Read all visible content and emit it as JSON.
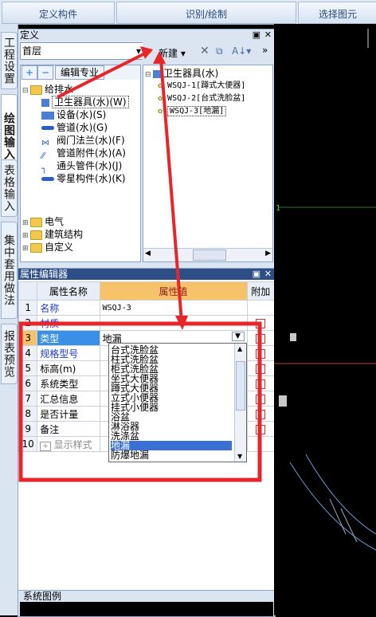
{
  "toolbar": {
    "define_component": "定义构件",
    "identify_draw": "识别/绘制",
    "select_figure": "选择图元"
  },
  "vtabs": [
    {
      "label": "工程设置"
    },
    {
      "label": "绘图输入"
    },
    {
      "label": "表格输入"
    },
    {
      "label": "集中套用做法"
    },
    {
      "label": "报表预览"
    }
  ],
  "define_panel": {
    "title": "定义",
    "floor": "首层",
    "edit_specialty": "编辑专业",
    "tree": {
      "root": "给排水",
      "items": [
        {
          "label": "卫生器具(水)(W)"
        },
        {
          "label": "设备(水)(S)"
        },
        {
          "label": "管道(水)(G)"
        },
        {
          "label": "阀门法兰(水)(F)"
        },
        {
          "label": "管道附件(水)(A)"
        },
        {
          "label": "通头管件(水)(J)"
        },
        {
          "label": "零星构件(水)(K)"
        }
      ],
      "folders": [
        "电气",
        "建筑结构",
        "自定义"
      ]
    },
    "new_button": "新建",
    "list_root": "卫生器具(水)",
    "list_items": [
      "WSQJ-1[蹲式大便器]",
      "WSQJ-2[台式洗脸盆]",
      "WSQJ-3[地漏]"
    ]
  },
  "prop_panel": {
    "title": "属性编辑器",
    "headers": {
      "name": "属性名称",
      "value": "属性值",
      "add": "附加"
    },
    "rows": [
      {
        "num": "1",
        "name": "名称",
        "value": "WSQJ-3"
      },
      {
        "num": "2",
        "name": "材质",
        "value": ""
      },
      {
        "num": "3",
        "name": "类型",
        "value": "地漏"
      },
      {
        "num": "4",
        "name": "规格型号",
        "value": ""
      },
      {
        "num": "5",
        "name": "标高(m)",
        "value": ""
      },
      {
        "num": "6",
        "name": "系统类型",
        "value": ""
      },
      {
        "num": "7",
        "name": "汇总信息",
        "value": ""
      },
      {
        "num": "8",
        "name": "是否计量",
        "value": ""
      },
      {
        "num": "9",
        "name": "备注",
        "value": ""
      },
      {
        "num": "10",
        "name": "显示样式",
        "value": ""
      }
    ],
    "dropdown_options": [
      "台式洗脸盆",
      "柱式洗脸盆",
      "柜式洗脸盆",
      "坐式大便器",
      "蹲式大便器",
      "立式小便器",
      "挂式小便器",
      "浴盆",
      "淋浴器",
      "洗涤盆",
      "地漏",
      "防爆地漏"
    ],
    "dropdown_selected": "地漏"
  },
  "legend": {
    "title": "系统图例"
  },
  "canvas": {
    "label": "1"
  },
  "colors": {
    "annotation": "#e8262a",
    "highlight": "#3a6fd6"
  }
}
